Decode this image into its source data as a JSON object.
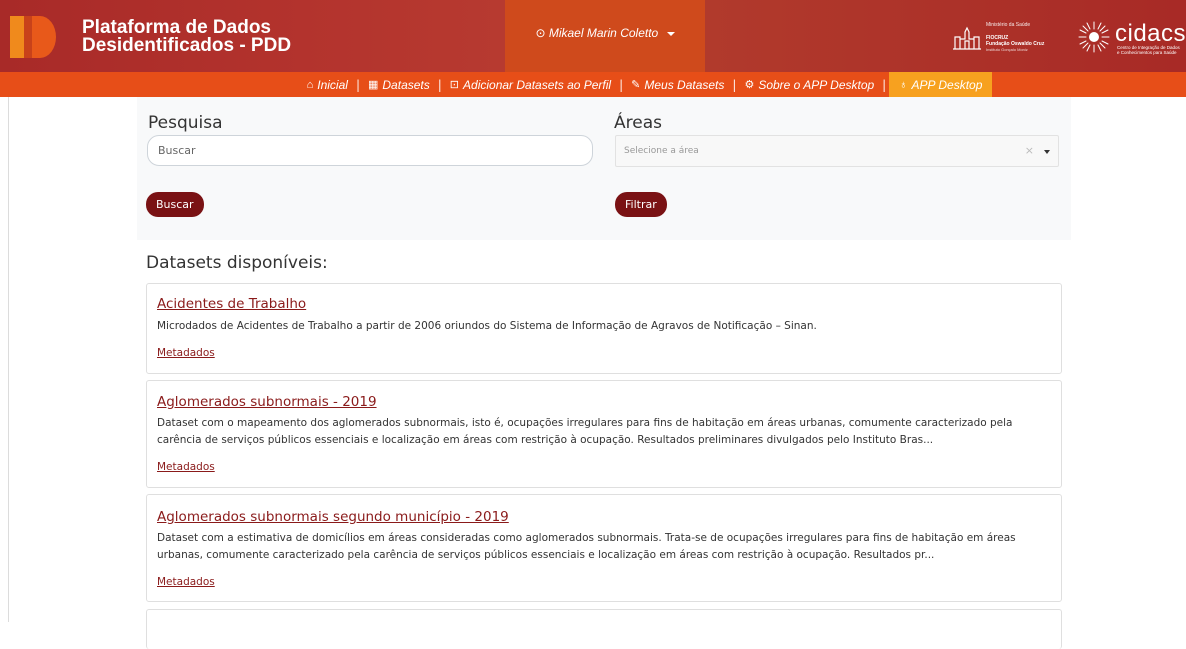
{
  "header": {
    "title_line1": "Plataforma de Dados",
    "title_line2": "Desidentificados - PDD",
    "user_name": "Mikael Marin Coletto",
    "fiocruz": {
      "ministry": "Ministério da Saúde",
      "line1": "FIOCRUZ",
      "line2": "Fundação Oswaldo Cruz",
      "line3": "Instituto Gonçalo Moniz"
    },
    "cidacs": {
      "name": "cidacs",
      "subtitle1": "Centro de Integração de Dados",
      "subtitle2": "e Conhecimentos para Saúde"
    }
  },
  "nav": {
    "items": [
      {
        "label": "Inicial",
        "icon": "home-icon"
      },
      {
        "label": "Datasets",
        "icon": "table-icon"
      },
      {
        "label": "Adicionar Datasets ao Perfil",
        "icon": "file-plus-icon"
      },
      {
        "label": "Meus Datasets",
        "icon": "edit-icon"
      },
      {
        "label": "Sobre o APP Desktop",
        "icon": "gear-icon"
      },
      {
        "label": "APP Desktop",
        "icon": "lightbulb-icon"
      }
    ],
    "separator": "|"
  },
  "search": {
    "label": "Pesquisa",
    "placeholder": "Buscar",
    "button": "Buscar"
  },
  "areas": {
    "label": "Áreas",
    "placeholder": "Selecione a área",
    "clear": "×",
    "button": "Filtrar"
  },
  "list": {
    "title": "Datasets disponíveis:",
    "items": [
      {
        "title": "Acidentes de Trabalho",
        "description": "Microdados de Acidentes de Trabalho a partir de 2006 oriundos do Sistema de Informação de Agravos de Notificação – Sinan.",
        "link": "Metadados"
      },
      {
        "title": "Aglomerados subnormais - 2019",
        "description": "Dataset com o mapeamento dos aglomerados subnormais, isto é, ocupações irregulares para fins de habitação em áreas urbanas, comumente caracterizado pela carência de serviços públicos essenciais e localização em áreas com restrição à ocupação. Resultados preliminares divulgados pelo Instituto Bras...",
        "link": "Metadados"
      },
      {
        "title": "Aglomerados subnormais segundo município - 2019",
        "description": "Dataset com a estimativa de domicílios em áreas consideradas como aglomerados subnormais. Trata-se de ocupações irregulares para fins de habitação em áreas urbanas, comumente caracterizado pela carência de serviços públicos essenciais e localização em áreas com restrição à ocupação. Resultados pr...",
        "link": "Metadados"
      }
    ]
  },
  "colors": {
    "header_red": "#a82a28",
    "nav_orange": "#e74e18",
    "active_yellow": "#f7a11f",
    "button_dark_red": "#7a1214",
    "link_red": "#8a1a1a"
  }
}
